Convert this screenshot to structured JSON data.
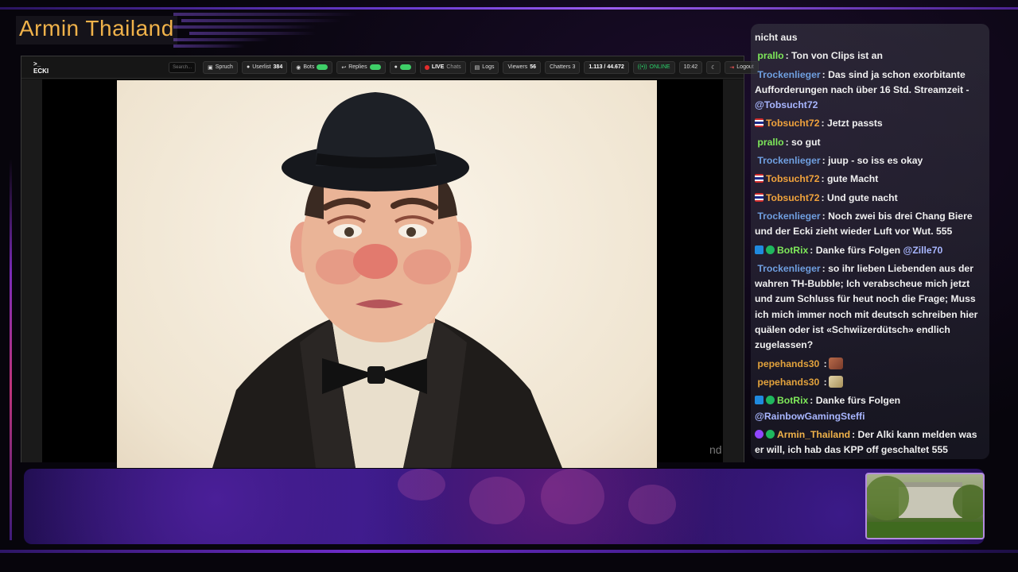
{
  "channel": {
    "title": "Armin Thailand"
  },
  "toolbar": {
    "brand": "ECKI",
    "search_placeholder": "Search...",
    "spruch": "Spruch",
    "userlist_label": "Userlist",
    "userlist_count": "384",
    "bots": "Bots",
    "replies": "Replies",
    "live": "LIVE",
    "chats": "Chats",
    "logs": "Logs",
    "viewers_label": "Viewers",
    "viewers_count": "56",
    "chatters": "Chatters 3",
    "stats": "1.113 / 44.672",
    "online": "ONLINE",
    "time": "10:42",
    "logout": "Logout"
  },
  "capture": {
    "cut_text": "nd"
  },
  "chat": {
    "messages": [
      {
        "user": "",
        "text": "nicht aus"
      },
      {
        "user": "prallo",
        "user_color": "#7ee85a",
        "text": ": Ton von Clips ist an"
      },
      {
        "user": "Trockenlieger",
        "user_color": "#6f9fe0",
        "text": ": Das sind ja schon exorbitante Aufforderungen nach über 16 Std. Streamzeit - ",
        "mention": "@Tobsucht72"
      },
      {
        "user": "Tobsucht72",
        "user_color": "#f0a23c",
        "text": ": Jetzt passts"
      },
      {
        "user": "prallo",
        "user_color": "#7ee85a",
        "text": ": so gut"
      },
      {
        "user": "Trockenlieger",
        "user_color": "#6f9fe0",
        "text": ": juup - so iss es okay"
      },
      {
        "user": "Tobsucht72",
        "user_color": "#f0a23c",
        "text": ": gute Macht"
      },
      {
        "user": "Tobsucht72",
        "user_color": "#f0a23c",
        "text": ": Und gute nacht"
      },
      {
        "user": "Trockenlieger",
        "user_color": "#6f9fe0",
        "text": ": Noch zwei bis drei Chang Biere und der Ecki zieht wieder Luft vor Wut. 555"
      },
      {
        "user": "BotRix",
        "user_color": "#7ee85a",
        "text": ": Danke fürs Folgen ",
        "mention": "@Zille70"
      },
      {
        "user": "Trockenlieger",
        "user_color": "#6f9fe0",
        "text": ": so ihr lieben Liebenden aus der wahren TH-Bubble; Ich verabscheue mich jetzt und zum Schluss für heut noch die Frage; Muss ich mich immer noch mit deutsch schreiben hier quälen oder ist «Schwiizerdütsch» endlich zugelassen?"
      },
      {
        "user": "pepehands30",
        "user_color": "#e2a23c",
        "text": " :"
      },
      {
        "user": "pepehands30",
        "user_color": "#e2a23c",
        "text": " :"
      },
      {
        "user": "BotRix",
        "user_color": "#7ee85a",
        "text": ": Danke fürs Folgen ",
        "mention": "@RainbowGamingSteffi"
      },
      {
        "user": "Armin_Thailand",
        "user_color": "#f0b24a",
        "text": ": Der Alki kann melden was er will, ich hab das KPP off geschaltet 555"
      }
    ]
  }
}
